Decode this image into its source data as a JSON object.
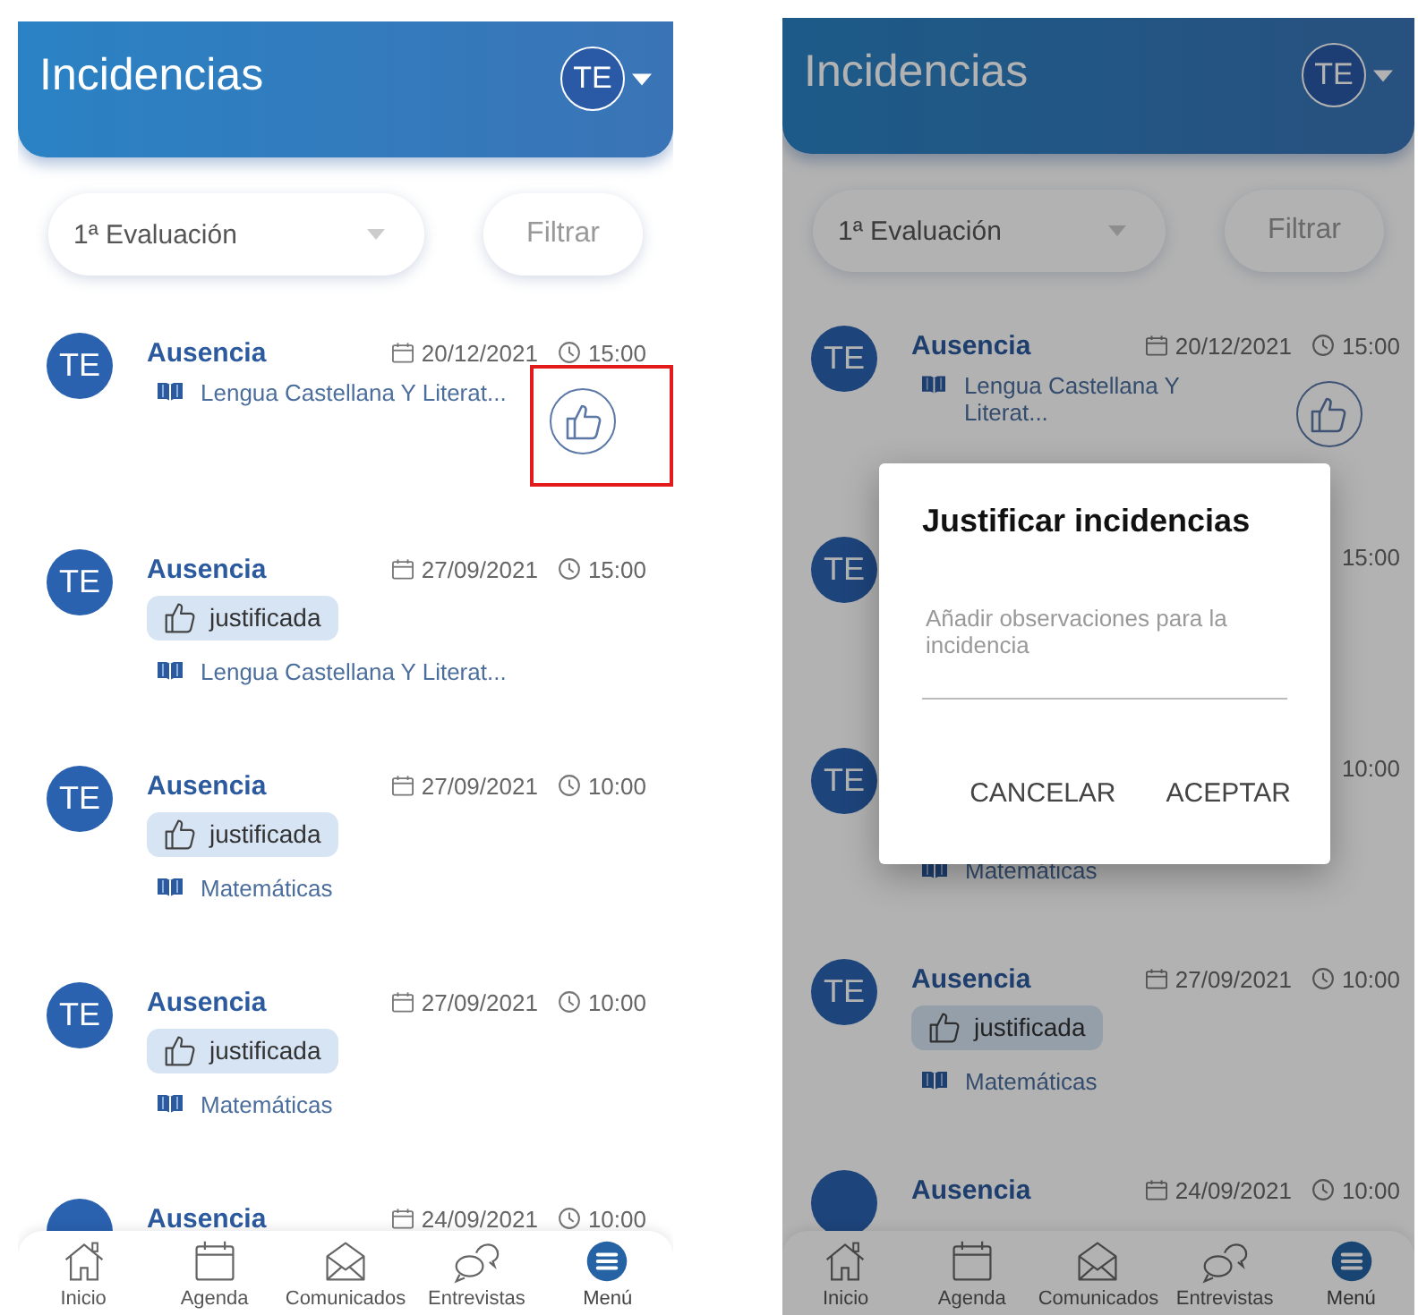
{
  "screens": [
    {
      "header": {
        "title": "Incidencias",
        "avatar": "TE"
      },
      "filters": {
        "period": "1ª Evaluación",
        "button": "Filtrar"
      },
      "items": [
        {
          "avatar": "TE",
          "title": "Ausencia",
          "date": "20/12/2021",
          "time": "15:00",
          "subject": "Lengua Castellana Y Literat...",
          "like_button": {
            "highlighted": true
          }
        },
        {
          "avatar": "TE",
          "title": "Ausencia",
          "date": "27/09/2021",
          "time": "15:00",
          "badge": "justificada",
          "subject": "Lengua Castellana Y Literat..."
        },
        {
          "avatar": "TE",
          "title": "Ausencia",
          "date": "27/09/2021",
          "time": "10:00",
          "badge": "justificada",
          "subject": "Matemáticas"
        },
        {
          "avatar": "TE",
          "title": "Ausencia",
          "date": "27/09/2021",
          "time": "10:00",
          "badge": "justificada",
          "subject": "Matemáticas"
        },
        {
          "title": "Ausencia",
          "date": "24/09/2021",
          "time": "10:00"
        }
      ],
      "nav": [
        {
          "kind": "home",
          "label": "Inicio",
          "selected": false
        },
        {
          "kind": "calendar",
          "label": "Agenda",
          "selected": false
        },
        {
          "kind": "mail",
          "label": "Comunicados",
          "selected": false
        },
        {
          "kind": "chat",
          "label": "Entrevistas",
          "selected": false
        },
        {
          "kind": "menu",
          "label": "Menú",
          "selected": true
        }
      ]
    },
    {
      "header": {
        "title": "Incidencias",
        "avatar": "TE"
      },
      "filters": {
        "period": "1ª Evaluación",
        "button": "Filtrar"
      },
      "items": [
        {
          "avatar": "TE",
          "title": "Ausencia",
          "date": "20/12/2021",
          "time": "15:00",
          "subject": "Lengua Castellana Y Literat...",
          "like_button": {
            "highlighted": false
          }
        },
        {
          "avatar": "TE",
          "time": "15:00"
        },
        {
          "avatar": "TE",
          "time": "10:00",
          "subject": "Matemáticas"
        },
        {
          "avatar": "TE",
          "title": "Ausencia",
          "date": "27/09/2021",
          "time": "10:00",
          "badge": "justificada",
          "subject": "Matemáticas"
        },
        {
          "title": "Ausencia",
          "date": "24/09/2021",
          "time": "10:00"
        }
      ],
      "nav": [
        {
          "kind": "home",
          "label": "Inicio",
          "selected": false
        },
        {
          "kind": "calendar",
          "label": "Agenda",
          "selected": false
        },
        {
          "kind": "mail",
          "label": "Comunicados",
          "selected": false
        },
        {
          "kind": "chat",
          "label": "Entrevistas",
          "selected": false
        },
        {
          "kind": "menu",
          "label": "Menú",
          "selected": true
        }
      ],
      "dialog": {
        "title": "Justificar incidencias",
        "placeholder": "Añadir observaciones para la incidencia",
        "buttons": [
          "CANCELAR",
          "ACEPTAR"
        ]
      }
    }
  ]
}
